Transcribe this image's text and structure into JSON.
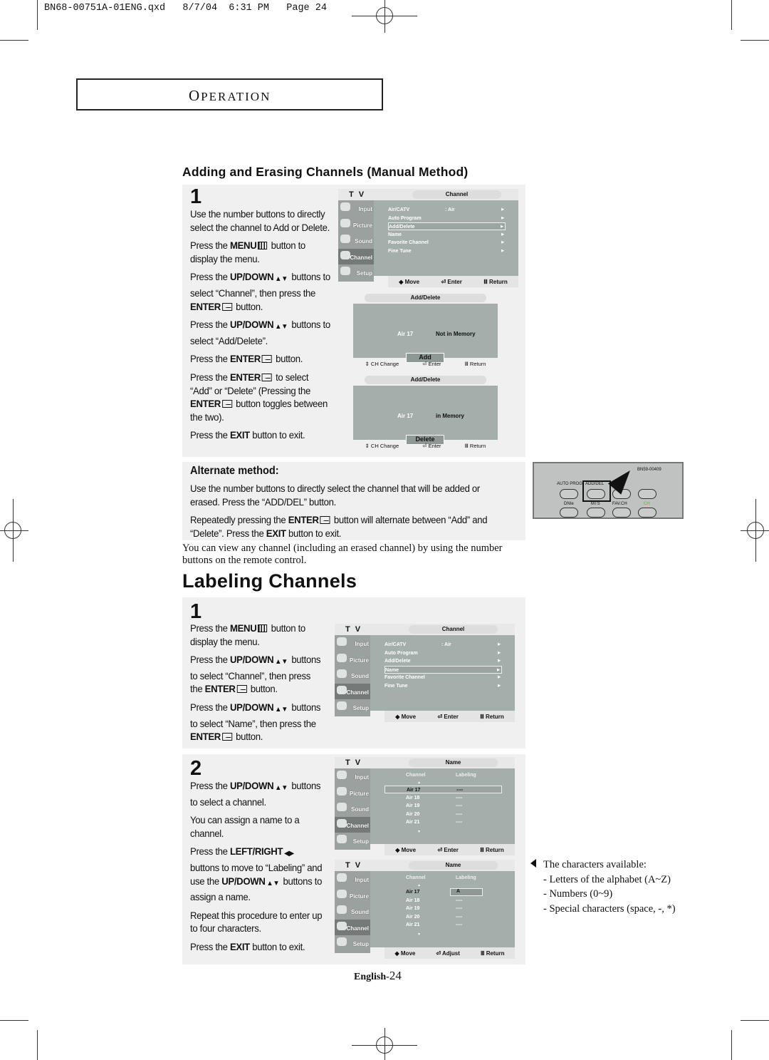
{
  "header": "BN68-00751A-01ENG.qxd   8/7/04  6:31 PM   Page 24",
  "section_tab": {
    "first": "O",
    "rest": "PERATION"
  },
  "adding": {
    "title": "Adding and Erasing Channels (Manual Method)",
    "step": "1",
    "paras": [
      [
        {
          "t": "Use the number buttons to directly select the channel to Add or Delete."
        }
      ],
      [
        {
          "t": "Press the "
        },
        {
          "t": "MENU",
          "b": 1
        },
        {
          "i": "menu"
        },
        {
          "t": " button to display the menu."
        }
      ],
      [
        {
          "t": "Press the "
        },
        {
          "t": "UP/DOWN",
          "b": 1
        },
        {
          "i": "updown"
        },
        {
          "t": " buttons to select “Channel”, then press the "
        },
        {
          "t": "ENTER",
          "b": 1
        },
        {
          "i": "enter"
        },
        {
          "t": " button."
        }
      ],
      [
        {
          "t": "Press the "
        },
        {
          "t": "UP/DOWN",
          "b": 1
        },
        {
          "i": "updown"
        },
        {
          "t": " buttons to select “Add/Delete”."
        }
      ],
      [
        {
          "t": "Press the "
        },
        {
          "t": "ENTER",
          "b": 1
        },
        {
          "i": "enter"
        },
        {
          "t": " button."
        }
      ],
      [
        {
          "t": "Press the "
        },
        {
          "t": "ENTER",
          "b": 1
        },
        {
          "i": "enter"
        },
        {
          "t": " to select “Add” or “Delete” (Pressing the "
        },
        {
          "t": "ENTER",
          "b": 1
        },
        {
          "i": "enter"
        },
        {
          "t": " button toggles between the two)."
        }
      ],
      [
        {
          "t": "Press the "
        },
        {
          "t": "EXIT",
          "b": 1
        },
        {
          "t": " button to exit."
        }
      ]
    ]
  },
  "alternate": {
    "title": "Alternate method:",
    "paras": [
      [
        {
          "t": "Use the number buttons to directly select the channel that will be added or erased. Press the “ADD/DEL” button."
        }
      ],
      [
        {
          "t": "Repeatedly pressing the "
        },
        {
          "t": "ENTER",
          "b": 1
        },
        {
          "i": "enter"
        },
        {
          "t": " button will alternate between “Add” and “Delete”.  Press the "
        },
        {
          "t": "EXIT",
          "b": 1
        },
        {
          "t": " button to exit."
        }
      ]
    ]
  },
  "view_note": "You can view any channel (including an erased channel) by using the number buttons on the remote control.",
  "labeling": {
    "title": "Labeling Channels",
    "step1": "1",
    "paras1": [
      [
        {
          "t": "Press the "
        },
        {
          "t": "MENU",
          "b": 1
        },
        {
          "i": "menu"
        },
        {
          "t": " button to display the menu."
        }
      ],
      [
        {
          "t": "Press the "
        },
        {
          "t": "UP/DOWN",
          "b": 1
        },
        {
          "i": "updown"
        },
        {
          "t": " buttons to select “Channel”, then press  the "
        },
        {
          "t": "ENTER",
          "b": 1
        },
        {
          "i": "enter"
        },
        {
          "t": " button."
        }
      ],
      [
        {
          "t": "Press the "
        },
        {
          "t": "UP/DOWN",
          "b": 1
        },
        {
          "i": "updown"
        },
        {
          "t": " buttons to select “Name”, then press the "
        },
        {
          "t": "ENTER",
          "b": 1
        },
        {
          "i": "enter"
        },
        {
          "t": " button."
        }
      ]
    ],
    "step2": "2",
    "paras2": [
      [
        {
          "t": "Press the "
        },
        {
          "t": "UP/DOWN",
          "b": 1
        },
        {
          "i": "updown"
        },
        {
          "t": " buttons to select a channel."
        }
      ],
      [
        {
          "t": "You can assign a name to a channel."
        }
      ],
      [
        {
          "t": "Press the "
        },
        {
          "t": "LEFT/RIGHT",
          "b": 1
        },
        {
          "i": "leftright"
        },
        {
          "t": " buttons to move to “Labeling” and use the "
        },
        {
          "t": "UP/DOWN",
          "b": 1
        },
        {
          "i": "updown"
        },
        {
          "t": " buttons to assign a name."
        }
      ],
      [
        {
          "t": "Repeat this procedure to enter up to four characters."
        }
      ],
      [
        {
          "t": "Press the "
        },
        {
          "t": "EXIT",
          "b": 1
        },
        {
          "t": " button to exit."
        }
      ]
    ]
  },
  "notes": {
    "head": "The characters available:",
    "items": [
      "- Letters of the alphabet (A~Z)",
      "- Numbers (0~9)",
      "- Special characters (space, -, *)"
    ]
  },
  "footer": {
    "lang": "English-",
    "page": "24"
  },
  "sidebar": [
    "Input",
    "Picture",
    "Sound",
    "Channel",
    "Setup"
  ],
  "menus": {
    "channel": {
      "tv": "T V",
      "title": "Channel",
      "rows": [
        [
          "Air/CATV",
          ":  Air"
        ],
        [
          "Auto Program",
          ""
        ],
        [
          "Add/Delete",
          ""
        ],
        [
          "Name",
          ""
        ],
        [
          "Favorite  Channel",
          ""
        ],
        [
          "Fine Tune",
          ""
        ]
      ],
      "foot": [
        "Move",
        "Enter",
        "Return"
      ]
    },
    "name": {
      "tv": "T V",
      "title": "Name",
      "cols": [
        "Channel",
        "Labeling"
      ],
      "channels": [
        "Air  17",
        "Air  18",
        "Air  19",
        "Air  20",
        "Air  21"
      ],
      "labels": [
        "----",
        "----",
        "----",
        "----",
        "----"
      ],
      "foot": [
        "Move",
        "Enter",
        "Return"
      ]
    },
    "name2": {
      "tv": "T V",
      "title": "Name",
      "cols": [
        "Channel",
        "Labeling"
      ],
      "channels": [
        "Air  17",
        "Air  18",
        "Air  19",
        "Air  20",
        "Air  21"
      ],
      "labels": [
        "A",
        "----",
        "----",
        "----",
        "----"
      ],
      "foot": [
        "Move",
        "Adjust",
        "Return"
      ]
    }
  },
  "dialogs": [
    {
      "title": "Add/Delete",
      "channel": "Air   17",
      "status": "Not in Memory",
      "button": "Add",
      "foot": [
        "CH Change",
        "Enter",
        "Return"
      ]
    },
    {
      "title": "Add/Delete",
      "channel": "Air  17",
      "status": "in Memory",
      "button": "Delete",
      "foot": [
        "CH Change",
        "Enter",
        "Return"
      ]
    }
  ],
  "remote": {
    "model": "BN59-00409",
    "buttons": [
      "AUTO PROG.",
      "ADD/DEL",
      "DNIe",
      "MTS",
      "FAV.CH",
      "CH"
    ],
    "ch_color": "#2bd12b"
  }
}
